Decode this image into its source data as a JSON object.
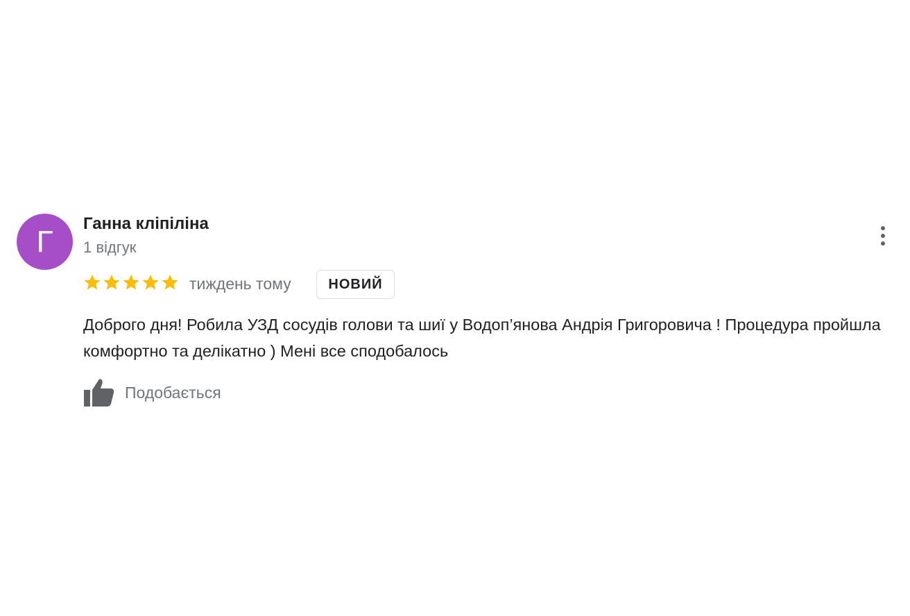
{
  "review": {
    "author": {
      "initial": "Г",
      "avatar_color": "#a64ec7",
      "name": "Ганна кліпіліна",
      "review_count": "1 відгук"
    },
    "rating": 5,
    "max_rating": 5,
    "star_color": "#fbbc04",
    "time_ago": "тиждень тому",
    "badge": "НОВИЙ",
    "text": "Доброго дня! Робила УЗД сосудів голови та шиї у Водоп’янова Андрія Григоровича ! Процедура пройшла комфортно та делікатно ) Мені все сподобалось",
    "like_label": "Подобається",
    "icons": {
      "more": "more-vert-icon",
      "like": "thumb-up-icon",
      "star": "star-icon"
    }
  }
}
